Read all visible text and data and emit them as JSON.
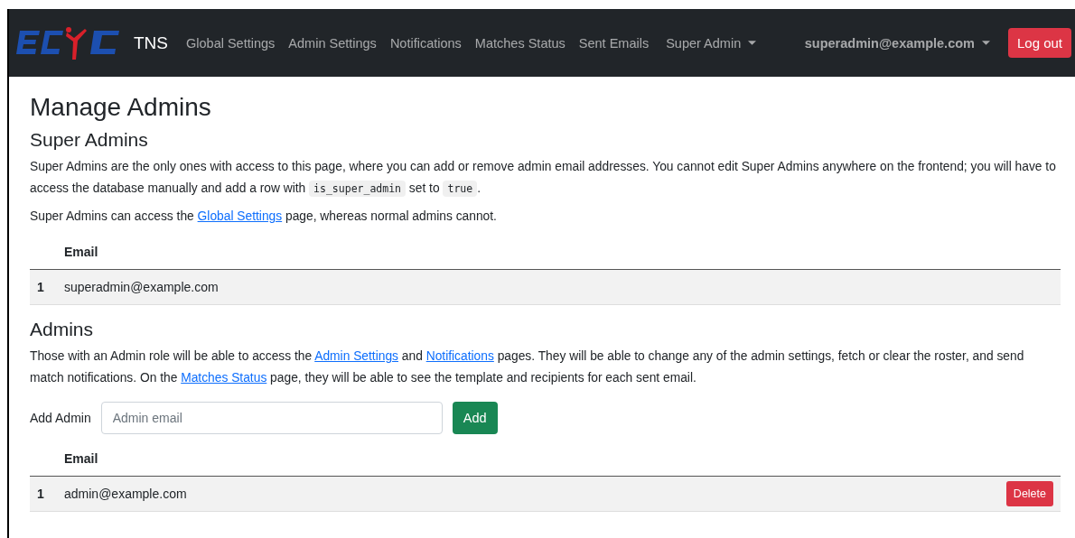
{
  "navbar": {
    "brand": "TNS",
    "links": [
      {
        "label": "Global Settings",
        "kind": "link"
      },
      {
        "label": "Admin Settings",
        "kind": "link"
      },
      {
        "label": "Notifications",
        "kind": "link"
      },
      {
        "label": "Matches Status",
        "kind": "link"
      },
      {
        "label": "Sent Emails",
        "kind": "link"
      },
      {
        "label": "Super Admin",
        "kind": "dropdown"
      }
    ],
    "user": "superadmin@example.com",
    "logout": "Log out"
  },
  "title": "Manage Admins",
  "sections": [
    {
      "heading": "Super Admins",
      "paragraphs": [
        [
          {
            "kind": "text",
            "text": "Super Admins are the only ones with access to this page, where you can add or remove admin email addresses. You cannot edit Super Admins anywhere on the frontend; you will have to access the database manually and add a row with "
          },
          {
            "kind": "code",
            "text": "is_super_admin"
          },
          {
            "kind": "text",
            "text": " set to "
          },
          {
            "kind": "code",
            "text": "true"
          },
          {
            "kind": "text",
            "text": "."
          }
        ],
        [
          {
            "kind": "text",
            "text": "Super Admins can access the "
          },
          {
            "kind": "link",
            "text": "Global Settings"
          },
          {
            "kind": "text",
            "text": " page, whereas normal admins cannot."
          }
        ]
      ],
      "table": {
        "columns": [
          "Email"
        ],
        "rows": [
          {
            "index": "1",
            "email": "superadmin@example.com"
          }
        ]
      }
    },
    {
      "heading": "Admins",
      "paragraphs": [
        [
          {
            "kind": "text",
            "text": "Those with an Admin role will be able to access the "
          },
          {
            "kind": "link",
            "text": "Admin Settings"
          },
          {
            "kind": "text",
            "text": " and "
          },
          {
            "kind": "link",
            "text": "Notifications"
          },
          {
            "kind": "text",
            "text": " pages. They will be able to change any of the admin settings, fetch or clear the roster, and send match notifications. On the "
          },
          {
            "kind": "link",
            "text": "Matches Status"
          },
          {
            "kind": "text",
            "text": " page, they will be able to see the template and recipients for each sent email."
          }
        ]
      ],
      "add_form": {
        "label": "Add Admin",
        "placeholder": "Admin email",
        "button": "Add"
      },
      "table": {
        "columns": [
          "Email"
        ],
        "rows": [
          {
            "index": "1",
            "email": "admin@example.com",
            "action": "Delete"
          }
        ]
      }
    }
  ]
}
